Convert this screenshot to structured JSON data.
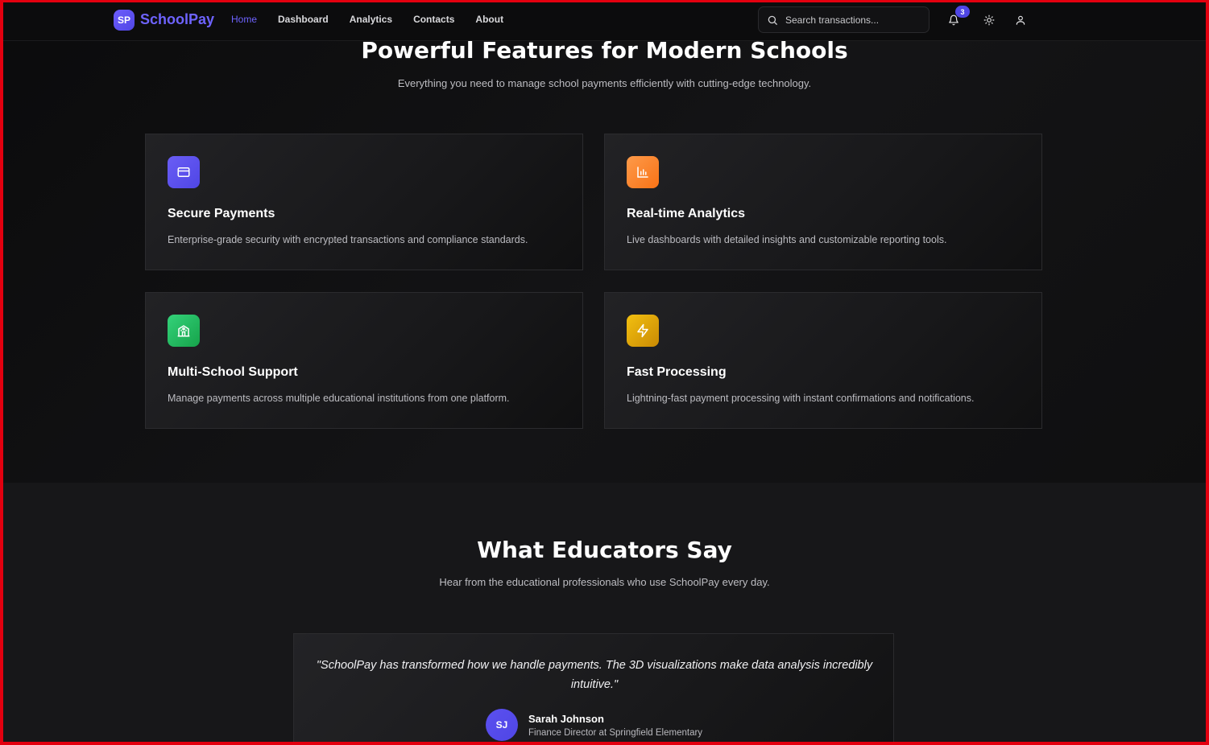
{
  "nav": {
    "logo_badge": "SP",
    "logo_text": "SchoolPay",
    "links": [
      "Home",
      "Dashboard",
      "Analytics",
      "Contacts",
      "About"
    ],
    "active_link": "Home",
    "search_placeholder": "Search transactions...",
    "notification_count": "3",
    "icons": [
      "search-icon",
      "bell-icon",
      "sun-icon",
      "user-icon"
    ]
  },
  "features": {
    "title": "Powerful Features for Modern Schools",
    "subtitle": "Everything you need to manage school payments efficiently with cutting-edge technology.",
    "cards": [
      {
        "title": "Secure Payments",
        "desc": "Enterprise-grade security with encrypted transactions and compliance standards.",
        "icon": "credit-card-icon",
        "color": "#5b50f0"
      },
      {
        "title": "Real-time Analytics",
        "desc": "Live dashboards with detailed insights and customizable reporting tools.",
        "icon": "bar-chart-icon",
        "color": "#fb8a3c"
      },
      {
        "title": "Multi-School Support",
        "desc": "Manage payments across multiple educational institutions from one platform.",
        "icon": "school-icon",
        "color": "#22c55e"
      },
      {
        "title": "Fast Processing",
        "desc": "Lightning-fast payment processing with instant confirmations and notifications.",
        "icon": "lightning-icon",
        "color": "#eab308"
      }
    ]
  },
  "testimonials": {
    "title": "What Educators Say",
    "subtitle": "Hear from the educational professionals who use SchoolPay every day.",
    "quote": "\"SchoolPay has transformed how we handle payments. The 3D visualizations make data analysis incredibly intuitive.\"",
    "author_initials": "SJ",
    "author_name": "Sarah Johnson",
    "author_role": "Finance Director at Springfield Elementary"
  },
  "colors": {
    "accent": "#6e63ff",
    "background": "#0f0f10",
    "border": "#e3000f"
  }
}
